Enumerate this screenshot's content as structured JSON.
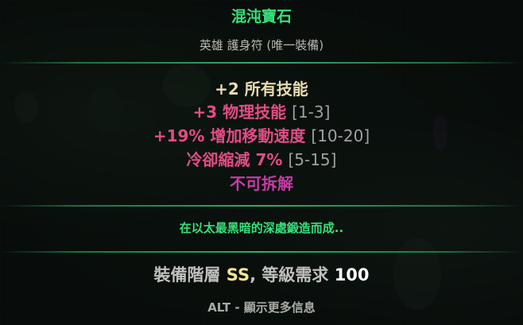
{
  "item": {
    "name": "混沌寶石",
    "type": "英雄 護身符 (唯一裝備)",
    "stats": [
      {
        "text": "+2 所有技能",
        "range": "",
        "color": "#e8dbb0"
      },
      {
        "text": "+3 物理技能",
        "range": "[1-3]",
        "color": "#e24c86"
      },
      {
        "text": "+19% 增加移動速度",
        "range": "[10-20]",
        "color": "#e24c86"
      },
      {
        "label": "冷卻縮減",
        "value": "7%",
        "range": "[5-15]",
        "color": "#e24c86"
      },
      {
        "text": "不可拆解",
        "range": "",
        "color": "#c93aa6"
      }
    ],
    "flavor": "在以太最黑暗的深處鍛造而成..",
    "tier_label": "裝備階層",
    "tier_value": "SS",
    "separator": ",",
    "level_label": "等級需求",
    "level_value": "100",
    "hint": "ALT - 顯示更多信息"
  },
  "colors": {
    "title": "#38e07b",
    "divider": "#2fae6e",
    "flavor": "#38e07b",
    "tier_value": "#f2e694"
  }
}
